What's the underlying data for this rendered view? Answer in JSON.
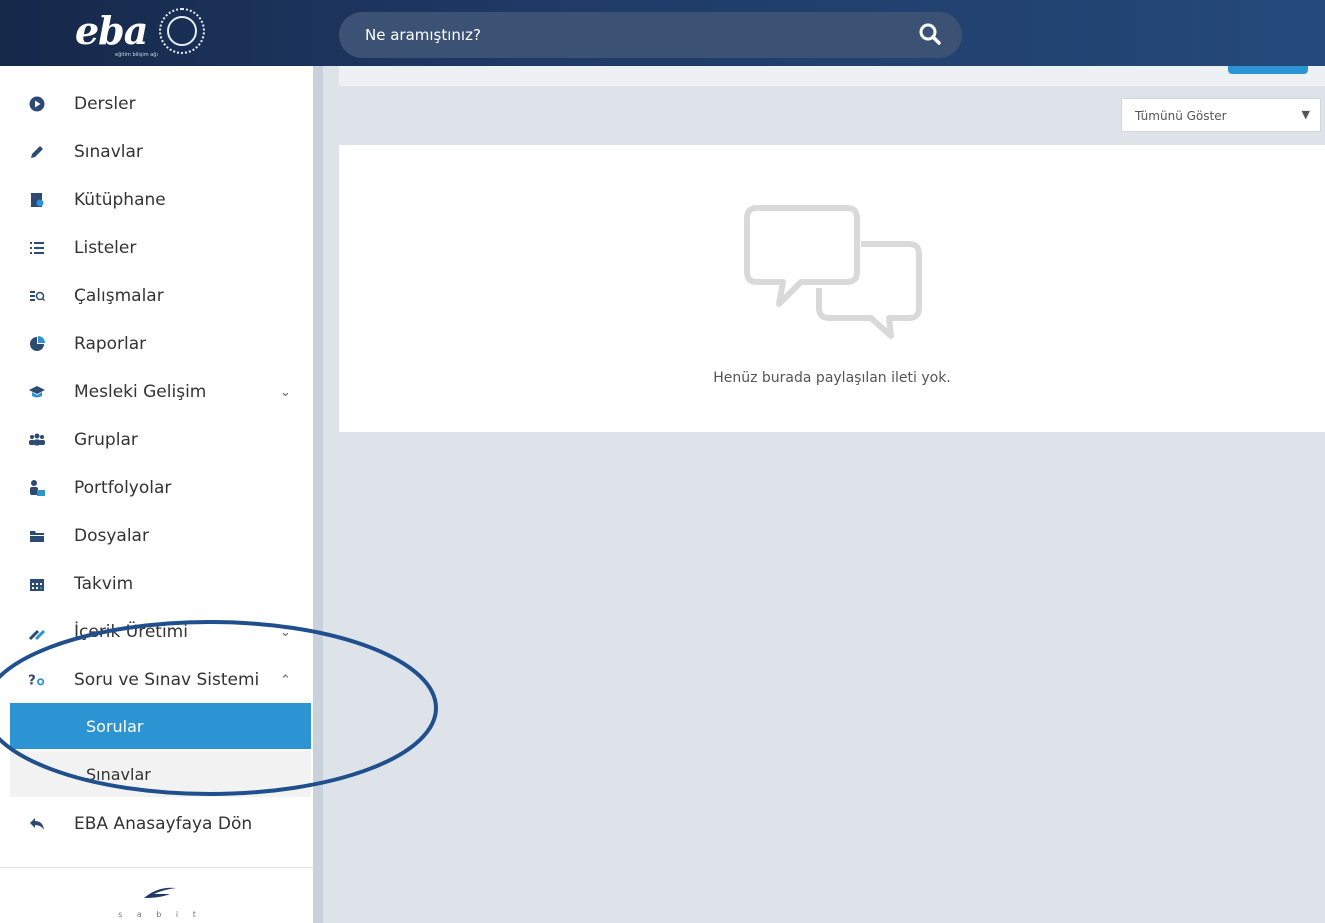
{
  "header": {
    "logo_text": "eba",
    "logo_sub": "eğitim bilişim ağı",
    "search_placeholder": "Ne aramıştınız?",
    "colors": {
      "topbar": "#1f3a66",
      "search_bg": "#3b5274"
    }
  },
  "sidebar": {
    "items": [
      {
        "label": "Dersler",
        "icon": "play-circle-icon"
      },
      {
        "label": "Sınavlar",
        "icon": "pencil-icon"
      },
      {
        "label": "Kütüphane",
        "icon": "library-icon"
      },
      {
        "label": "Listeler",
        "icon": "list-icon"
      },
      {
        "label": "Çalışmalar",
        "icon": "search-list-icon"
      },
      {
        "label": "Raporlar",
        "icon": "pie-chart-icon"
      },
      {
        "label": "Mesleki Gelişim",
        "icon": "graduation-cap-icon",
        "chevron": "v"
      },
      {
        "label": "Gruplar",
        "icon": "users-icon"
      },
      {
        "label": "Portfolyolar",
        "icon": "user-briefcase-icon"
      },
      {
        "label": "Dosyalar",
        "icon": "folder-icon"
      },
      {
        "label": "Takvim",
        "icon": "calendar-icon"
      },
      {
        "label": "İçerik Üretimi",
        "icon": "tools-icon",
        "chevron": "v"
      },
      {
        "label": "Soru ve Sınav Sistemi",
        "icon": "question-icon",
        "chevron": "^"
      }
    ],
    "sub_items": [
      {
        "label": "Sorular",
        "active": true
      },
      {
        "label": "Sınavlar",
        "active": false
      }
    ],
    "back_item": {
      "label": "EBA Anasayfaya Dön",
      "icon": "reply-icon"
    },
    "bottom_logo_text": "s a b i t",
    "accent": "#2d94d3"
  },
  "content": {
    "filter_value": "Tümünü Göster",
    "empty_message": "Henüz burada paylaşılan ileti yok."
  }
}
